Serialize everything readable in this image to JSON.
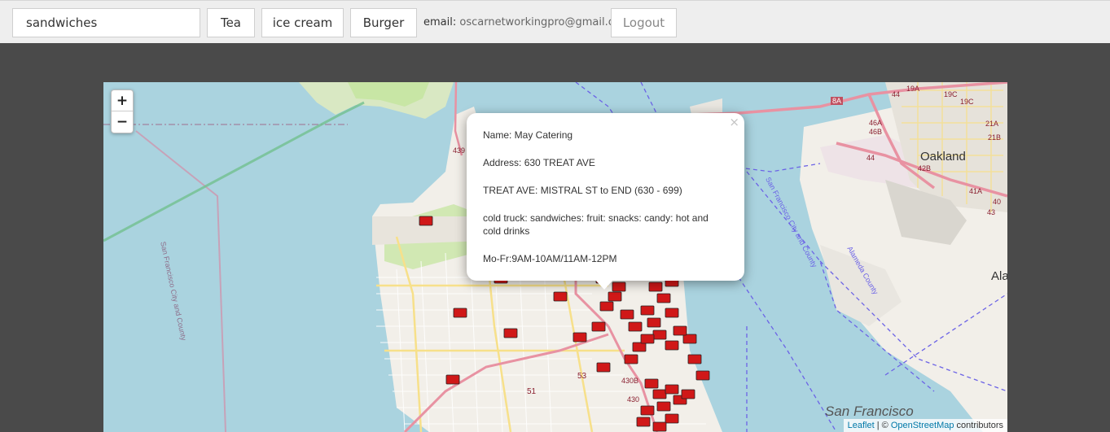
{
  "search": {
    "value": "sandwiches"
  },
  "quick_buttons": [
    "Tea",
    "ice cream",
    "Burger"
  ],
  "account": {
    "email_label": "email:",
    "email_value": "oscarnetworkingpro@gmail.com",
    "logout_label": "Logout"
  },
  "map": {
    "zoom_in": "+",
    "zoom_out": "−",
    "place_labels": [
      "Oakland",
      "San Francisco",
      "Ala"
    ],
    "boundary_labels": [
      "San Francisco City and County",
      "San Francisco City and County",
      "Alameda County"
    ],
    "route_shields": [
      "8A",
      "19A",
      "19C",
      "19C",
      "44",
      "46A",
      "46B",
      "44",
      "42B",
      "41A",
      "40",
      "21A",
      "21B",
      "43",
      "53",
      "51",
      "430B",
      "430",
      "439"
    ],
    "popup": {
      "close": "×",
      "name": "Name: May Catering",
      "address": "Address: 630 TREAT AVE",
      "location": "TREAT AVE: MISTRAL ST to END (630 - 699)",
      "items": "cold truck: sandwiches: fruit: snacks: candy: hot and cold drinks",
      "hours": "Mo-Fr:9AM-10AM/11AM-12PM"
    },
    "attribution": {
      "leaflet": "Leaflet",
      "sep": " | © ",
      "osm": "OpenStreetMap",
      "suffix": " contributors"
    }
  },
  "colors": {
    "water": "#aad3df",
    "land": "#f2efe9",
    "park": "#c8e6a5",
    "highway": "#e892a2",
    "truck_marker": "#d01818"
  }
}
